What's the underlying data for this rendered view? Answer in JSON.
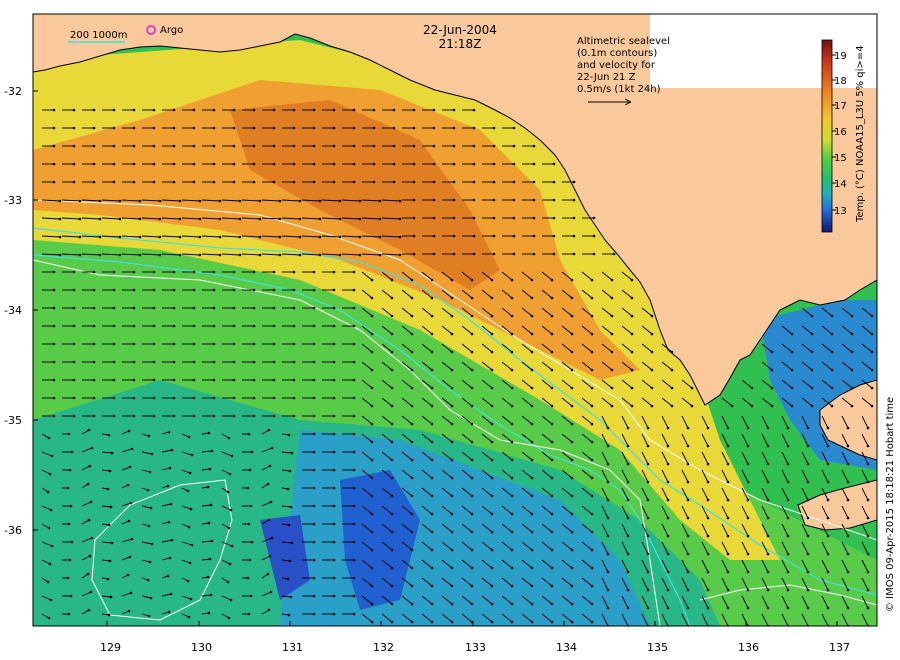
{
  "header": {
    "date": "22-Jun-2004",
    "time": "21:18Z"
  },
  "legend": {
    "isobath_label": "200  1000m",
    "argo_label": "Argo"
  },
  "info": {
    "lines": [
      "Altimetric sealevel",
      "(0.1m contours)",
      "and velocity for",
      "22-Jun 21 Z",
      "0.5m/s (1kt 24h)"
    ]
  },
  "colorbar": {
    "title": "Temp. (°C) NOAA15_L3U 5% qi>=4",
    "ticks": [
      "19",
      "18",
      "17",
      "16",
      "15",
      "14",
      "13"
    ],
    "colors": [
      "#8b1a1a",
      "#d03a1a",
      "#f08a20",
      "#f0c830",
      "#c8e030",
      "#60d040",
      "#20c060",
      "#20b0b0",
      "#2080e0",
      "#1840c0",
      "#101880"
    ]
  },
  "axes": {
    "x_ticks": [
      "129",
      "130",
      "131",
      "132",
      "133",
      "134",
      "135",
      "136",
      "137"
    ],
    "y_ticks": [
      "-32",
      "-33",
      "-34",
      "-35",
      "-36"
    ]
  },
  "credit": "© IMOS 09-Apr-2015 18:18:21 Hobart time",
  "colors": {
    "land": "#f9c89b",
    "coast": "#000000",
    "isobath": "#40e0e0",
    "contour": "#ffffff"
  }
}
